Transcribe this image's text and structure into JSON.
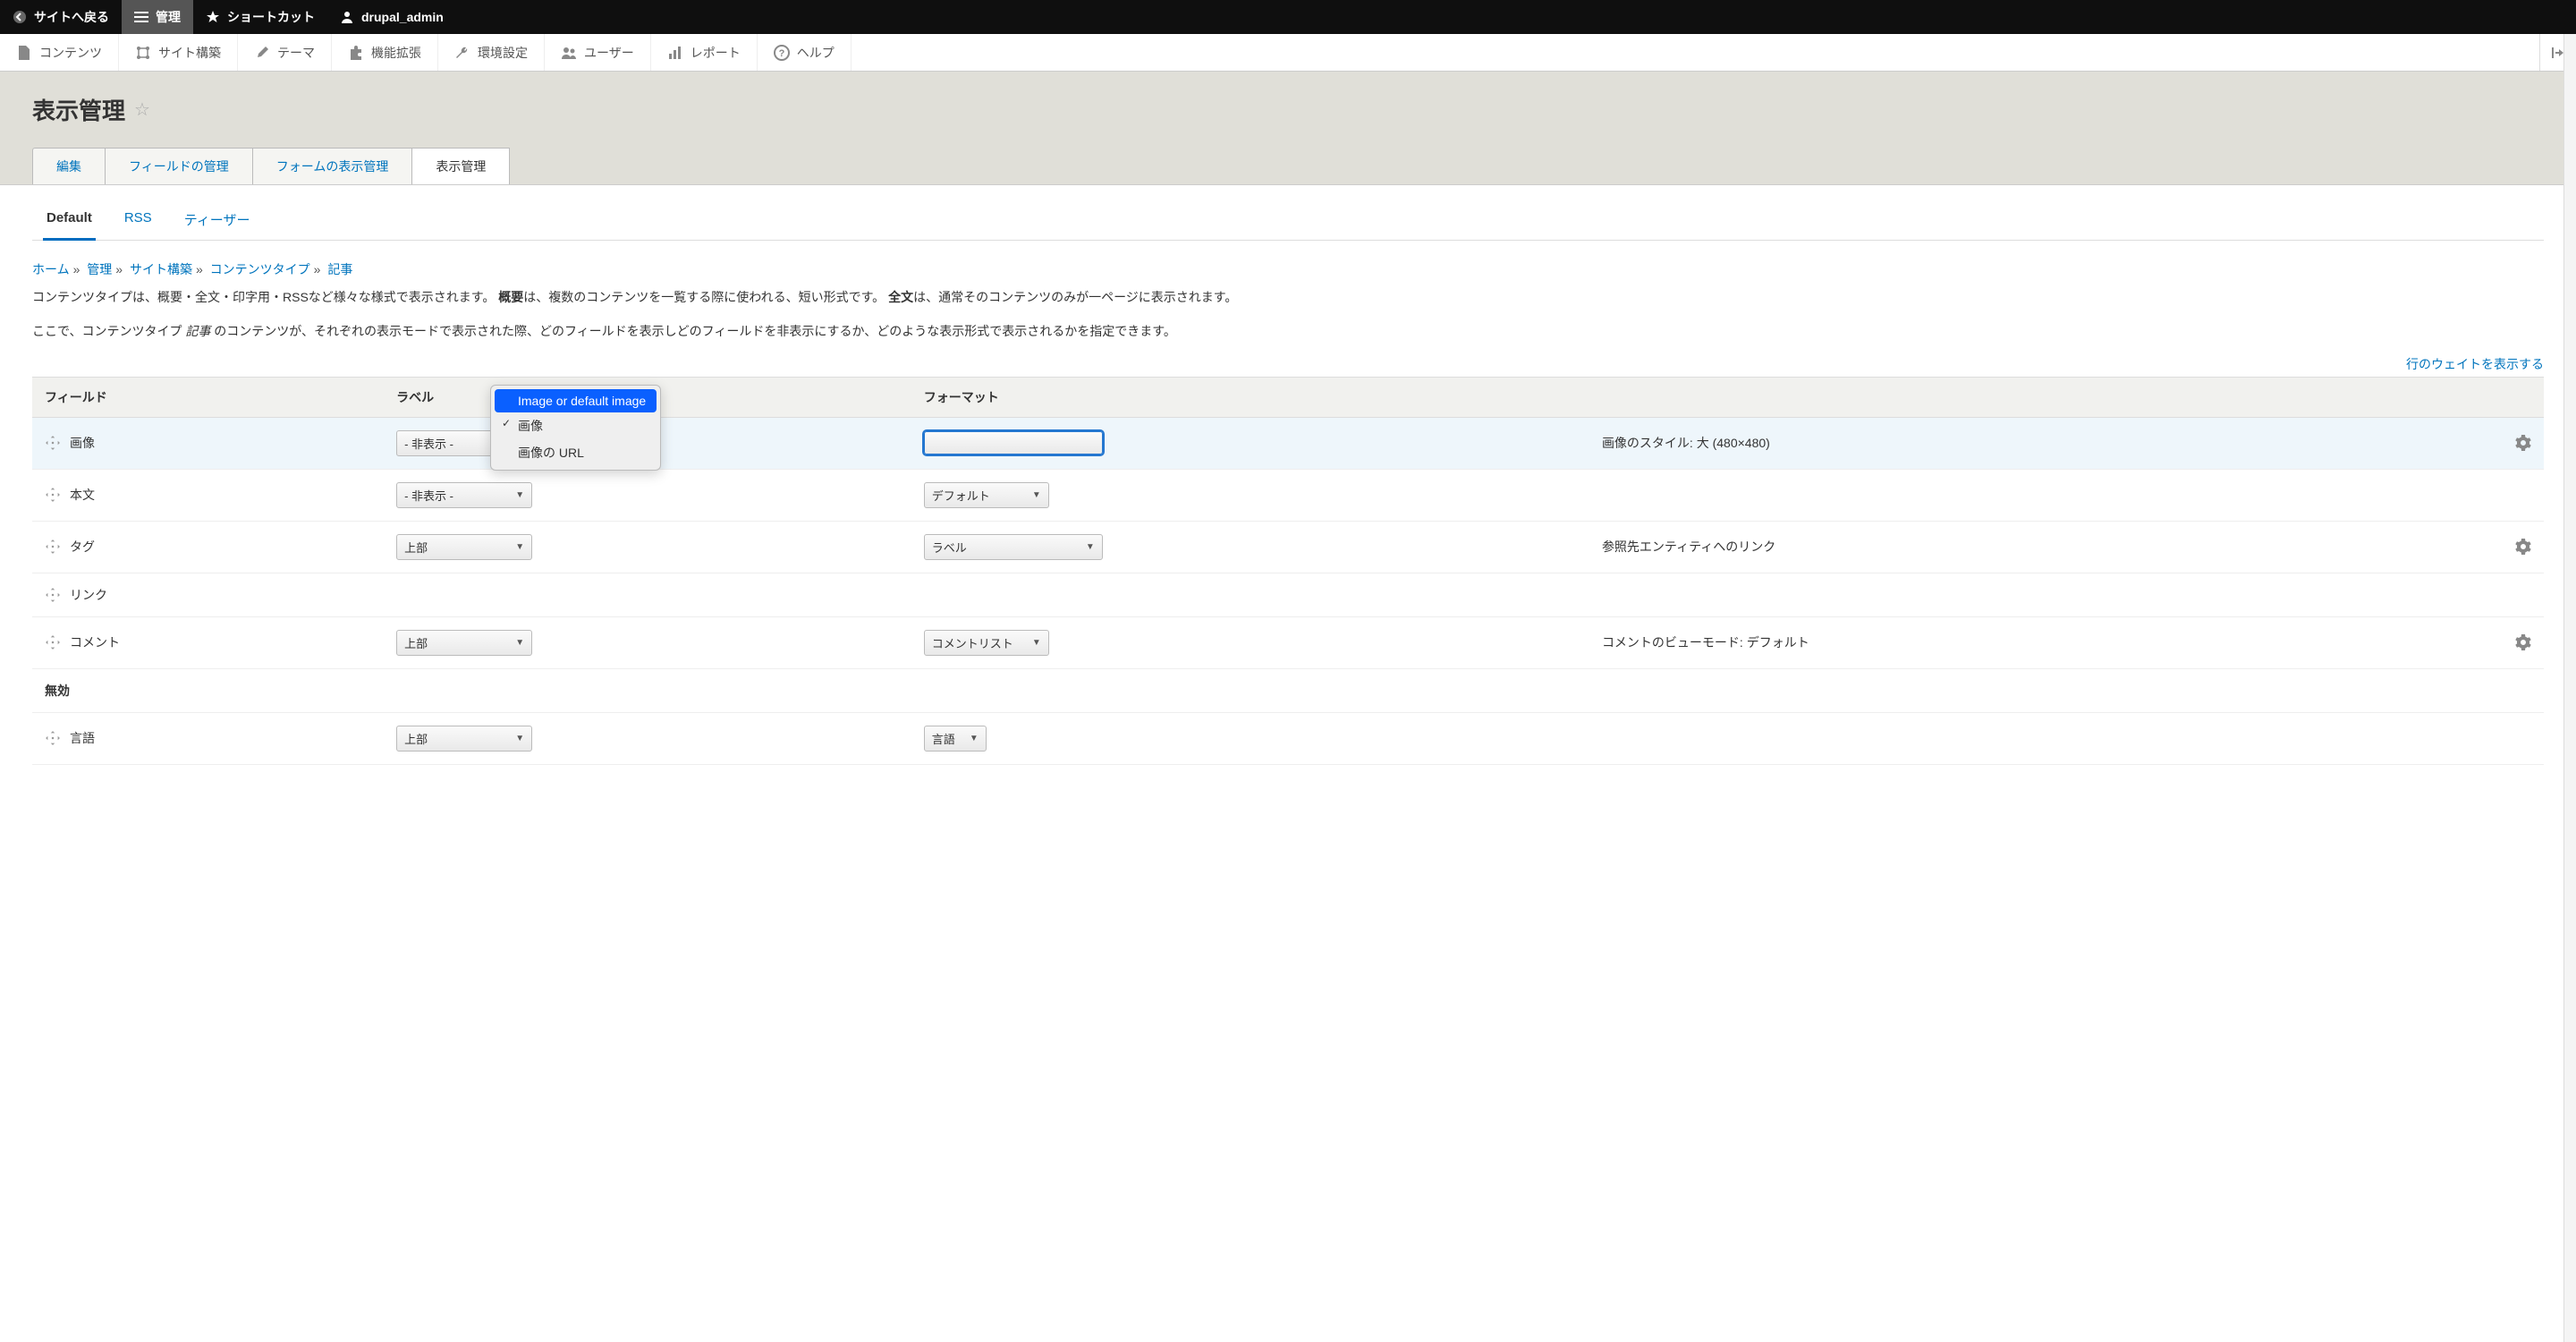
{
  "top_toolbar": {
    "back": "サイトへ戻る",
    "manage": "管理",
    "shortcuts": "ショートカット",
    "user": "drupal_admin"
  },
  "admin_menu": {
    "content": "コンテンツ",
    "structure": "サイト構築",
    "appearance": "テーマ",
    "extend": "機能拡張",
    "config": "環境設定",
    "people": "ユーザー",
    "reports": "レポート",
    "help": "ヘルプ"
  },
  "page_title": "表示管理",
  "primary_tabs": {
    "edit": "編集",
    "manage_fields": "フィールドの管理",
    "manage_form": "フォームの表示管理",
    "manage_display": "表示管理"
  },
  "secondary_tabs": {
    "default": "Default",
    "rss": "RSS",
    "teaser": "ティーザー"
  },
  "breadcrumb": {
    "home": "ホーム",
    "manage": "管理",
    "structure": "サイト構築",
    "content_types": "コンテンツタイプ",
    "article": "記事"
  },
  "intro": {
    "line1_pre": "コンテンツタイプは、概要・全文・印字用・RSSなど様々な様式で表示されます。 ",
    "line1_b1": "概要",
    "line1_mid": "は、複数のコンテンツを一覧する際に使われる、短い形式です。 ",
    "line1_b2": "全文",
    "line1_post": "は、通常そのコンテンツのみが一ページに表示されます。",
    "line2_pre": "ここで、コンテンツタイプ ",
    "line2_i": "記事",
    "line2_post": " のコンテンツが、それぞれの表示モードで表示された際、どのフィールドを表示しどのフィールドを非表示にするか、どのような表示形式で表示されるかを指定できます。"
  },
  "weights_link": "行のウェイトを表示する",
  "table": {
    "head": {
      "field": "フィールド",
      "label": "ラベル",
      "format": "フォーマット"
    },
    "rows": [
      {
        "field": "画像",
        "label_sel": "- 非表示 -",
        "format_sel": "",
        "info": "画像のスタイル: 大 (480×480)",
        "gear": true,
        "highlighted": true,
        "label_wide": true
      },
      {
        "field": "本文",
        "label_sel": "- 非表示 -",
        "format_sel": "デフォルト",
        "info": "",
        "gear": false,
        "label_wide": true,
        "format_narrow": true
      },
      {
        "field": "タグ",
        "label_sel": "上部",
        "format_sel": "ラベル",
        "info": "参照先エンティティへのリンク",
        "gear": true,
        "label_wide": true,
        "format_wider": true
      },
      {
        "field": "リンク",
        "label_sel": "",
        "format_sel": "",
        "info": "",
        "gear": false
      },
      {
        "field": "コメント",
        "label_sel": "上部",
        "format_sel": "コメントリスト",
        "info": "コメントのビューモード: デフォルト",
        "gear": true,
        "label_wide": true,
        "format_narrow": true
      }
    ],
    "disabled_section": "無効",
    "disabled_rows": [
      {
        "field": "言語",
        "label_sel": "上部",
        "format_sel": "言語",
        "info": "",
        "gear": false,
        "label_wide": true
      }
    ]
  },
  "dropdown": {
    "item1": "Image or default image",
    "item2": "画像",
    "item3": "画像の URL"
  }
}
